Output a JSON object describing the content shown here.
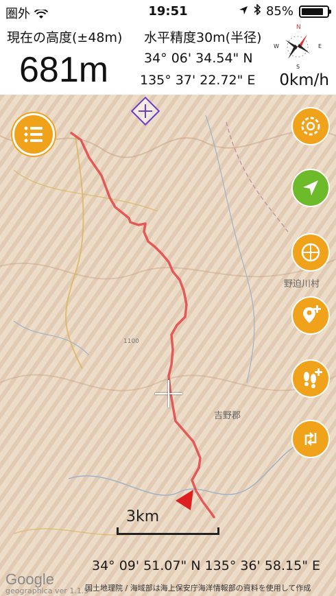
{
  "status_bar": {
    "carrier": "圏外",
    "time": "19:51",
    "battery": "85%",
    "battery_level": 0.85
  },
  "header": {
    "altitude_label": "現在の高度(±48m)",
    "altitude_value": "681m",
    "accuracy_label": "水平精度30m(半径)",
    "latitude": "34° 06' 34.54\" N",
    "longitude": "135° 37' 22.72\" E",
    "speed": "0km/h",
    "compass": {
      "n": "N",
      "e": "E",
      "s": "S",
      "w": "W"
    }
  },
  "map": {
    "scale_label": "3km",
    "center_coords": "34° 09' 51.07\" N 135° 36' 58.15\" E",
    "credit": "国土地理院 / 海域部は海上保安庁海洋情報部の資料を使用して作成",
    "google_logo": "Google",
    "watermark": "geographica ver 1.1.5",
    "place_nosegawa": "野迫川村",
    "place_yoshino": "吉野郡",
    "elevation_1100": "1100"
  },
  "colors": {
    "accent": "#f0a21a",
    "locate": "#6dba2b",
    "track": "#e34b4b",
    "waypoint": "#6a3ec9"
  },
  "buttons": [
    {
      "icon": "layers-icon"
    },
    {
      "icon": "locate-arrow-icon"
    },
    {
      "icon": "compass-rotate-icon"
    },
    {
      "icon": "add-pin-icon"
    },
    {
      "icon": "add-footprint-icon"
    },
    {
      "icon": "route-icon"
    }
  ]
}
